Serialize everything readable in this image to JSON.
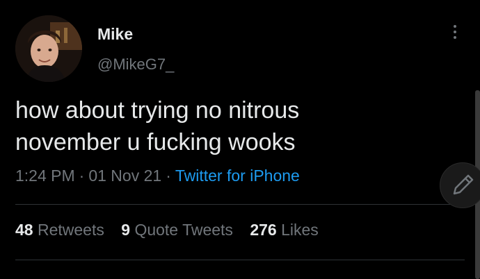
{
  "author": {
    "display_name": "Mike",
    "handle": "@MikeG7_"
  },
  "tweet": {
    "text_line1": "how about trying no nitrous",
    "text_line2": "november u fucking wooks",
    "time": "1:24 PM",
    "separator": "·",
    "date": "01 Nov 21",
    "source": "Twitter for iPhone"
  },
  "stats": {
    "retweets_count": "48",
    "retweets_label": "Retweets",
    "quotes_count": "9",
    "quotes_label": "Quote Tweets",
    "likes_count": "276",
    "likes_label": "Likes"
  },
  "icons": {
    "more": "more-vertical-icon",
    "compose": "compose-pencil-icon"
  },
  "colors": {
    "background": "#000000",
    "text": "#e7e9ea",
    "muted": "#71767b",
    "link": "#1d9bf0",
    "divider": "#2f3336"
  }
}
